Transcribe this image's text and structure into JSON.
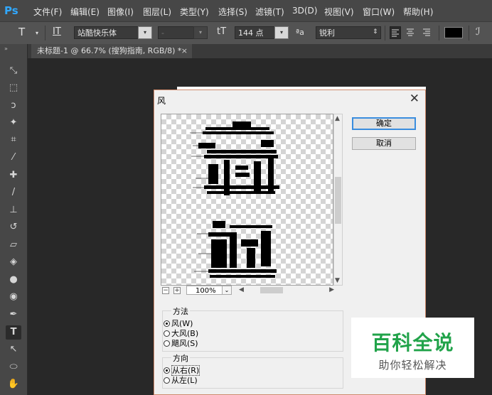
{
  "app": {
    "logo": "Ps"
  },
  "menu": [
    "文件(F)",
    "编辑(E)",
    "图像(I)",
    "图层(L)",
    "类型(Y)",
    "选择(S)",
    "滤镜(T)",
    "3D(D)",
    "视图(V)",
    "窗口(W)",
    "帮助(H)"
  ],
  "options": {
    "tool_glyph": "T",
    "orient_glyph": "IT",
    "font_family": "站酷快乐体",
    "font_style": "-",
    "size_glyph": "tT",
    "font_size": "144 点",
    "aa_glyph": "ªa",
    "antialias": "锐利",
    "text_color": "#000000"
  },
  "document": {
    "tab_title": "未标题-1 @ 66.7% (搜狗指南, RGB/8) *",
    "close": "×"
  },
  "dialog": {
    "title": "风",
    "close": "✕",
    "preview_zoom": "100%",
    "zoom_minus": "−",
    "zoom_plus": "+",
    "ok": "确定",
    "cancel": "取消",
    "method": {
      "label": "方法",
      "options": [
        "风(W)",
        "大风(B)",
        "飓风(S)"
      ],
      "selected": "风(W)"
    },
    "direction": {
      "label": "方向",
      "options": [
        "从右(R)",
        "从左(L)"
      ],
      "selected": "从右(R)"
    }
  },
  "watermark": {
    "main": "百科全说",
    "sub": "助你轻松解决"
  }
}
